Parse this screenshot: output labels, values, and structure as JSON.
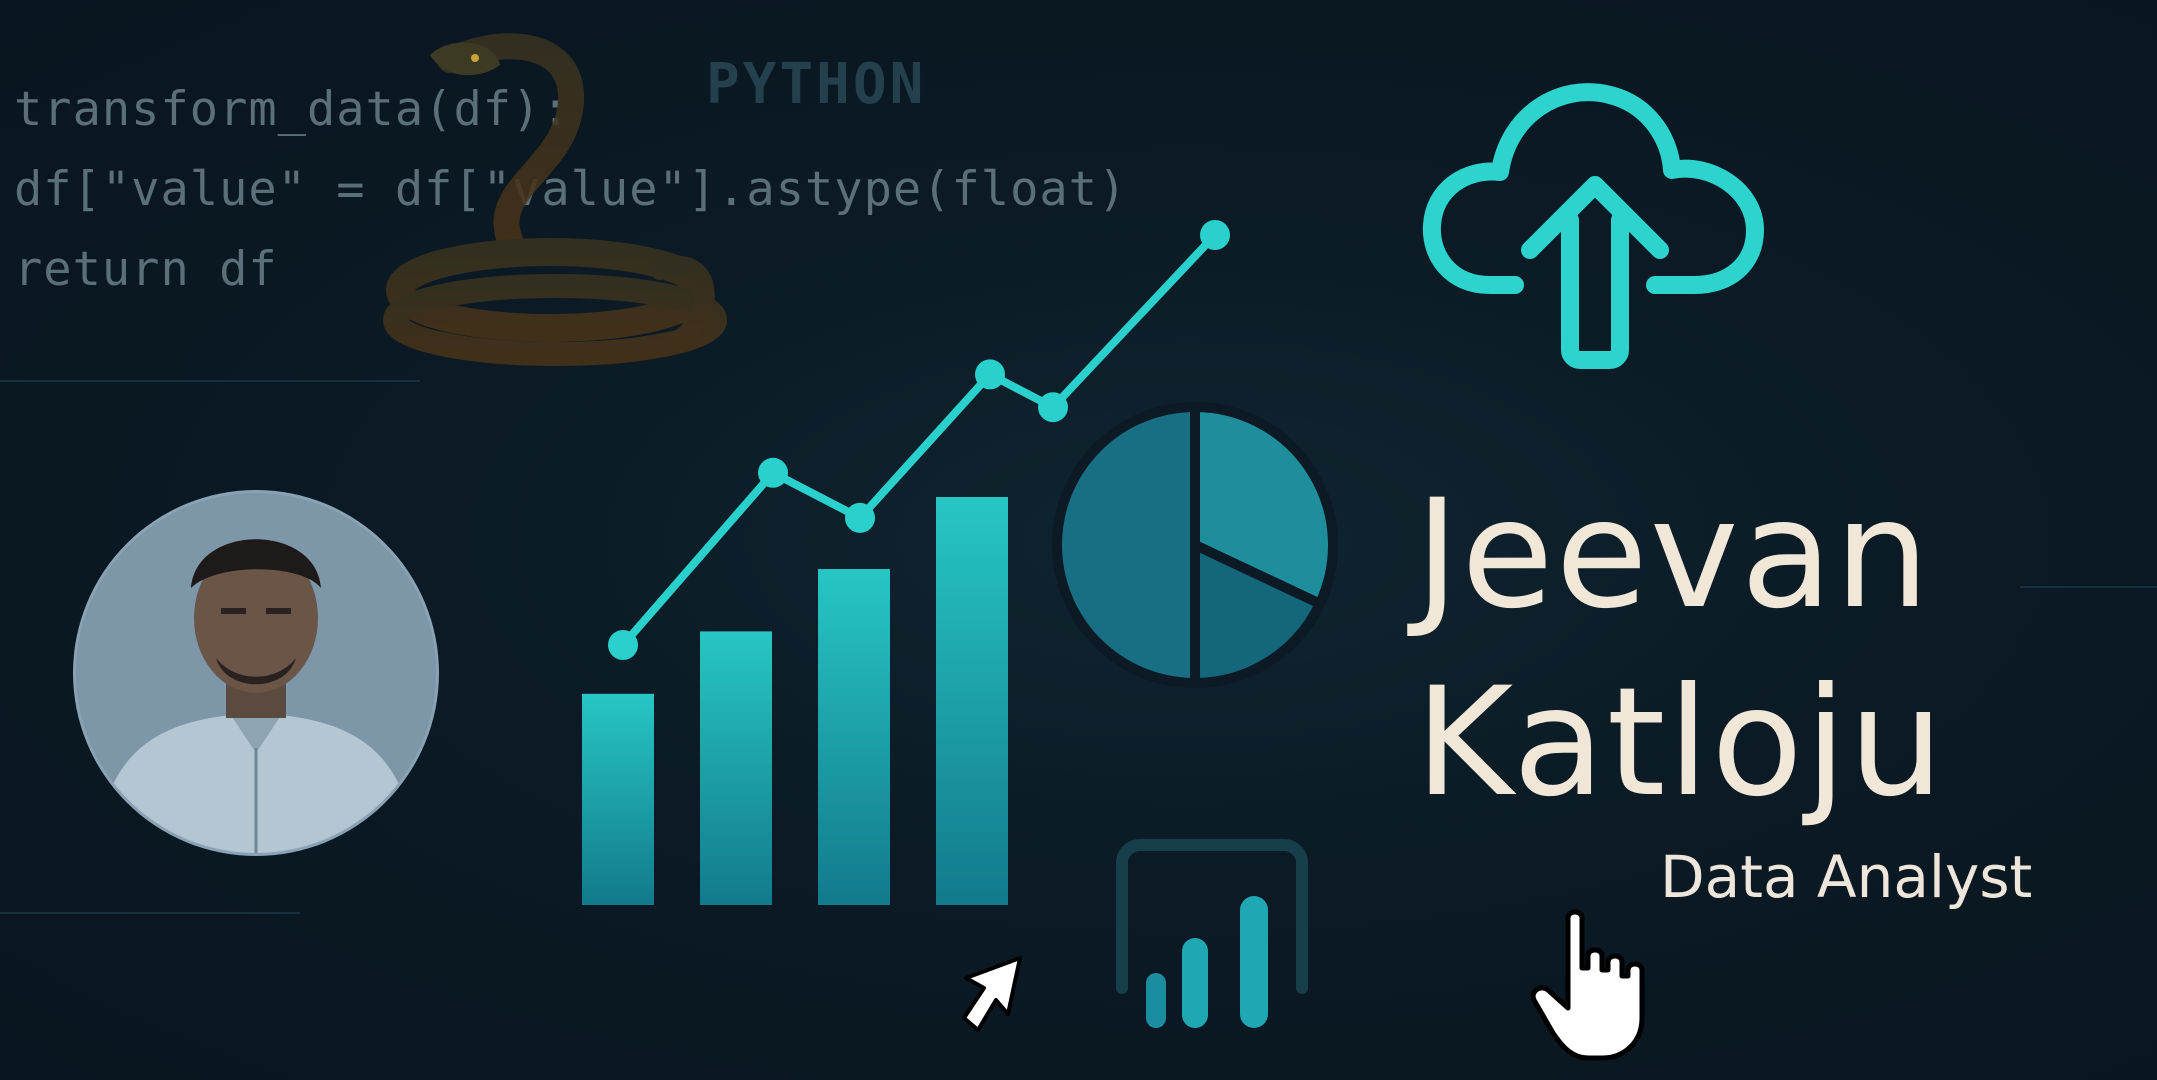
{
  "code": {
    "lines": [
      "transform_data(df):",
      "df[\"value\" = df[\"value\"].astype(float)",
      "return df"
    ],
    "language_label": "PYTHON"
  },
  "profile": {
    "first_name": "Jeevan",
    "last_name": "Katloju",
    "role": "Data Analyst"
  },
  "icons": {
    "snake": "python-snake-icon",
    "cloud": "cloud-upload-icon",
    "pie": "pie-chart-icon",
    "bar_report": "power-bi-icon",
    "cursor_arrow": "arrow-cursor-icon",
    "cursor_hand": "hand-pointer-icon"
  },
  "colors": {
    "accent": "#2ad0cc",
    "background": "#0b1a24",
    "name_text": "#f1e7d8"
  },
  "decorative_chart": {
    "bars": [
      0.44,
      0.57,
      0.7,
      0.85
    ],
    "line": [
      0.0,
      0.42,
      0.31,
      0.66,
      0.58,
      1.0
    ],
    "pie_slices": [
      0.32,
      0.18,
      0.5
    ]
  }
}
